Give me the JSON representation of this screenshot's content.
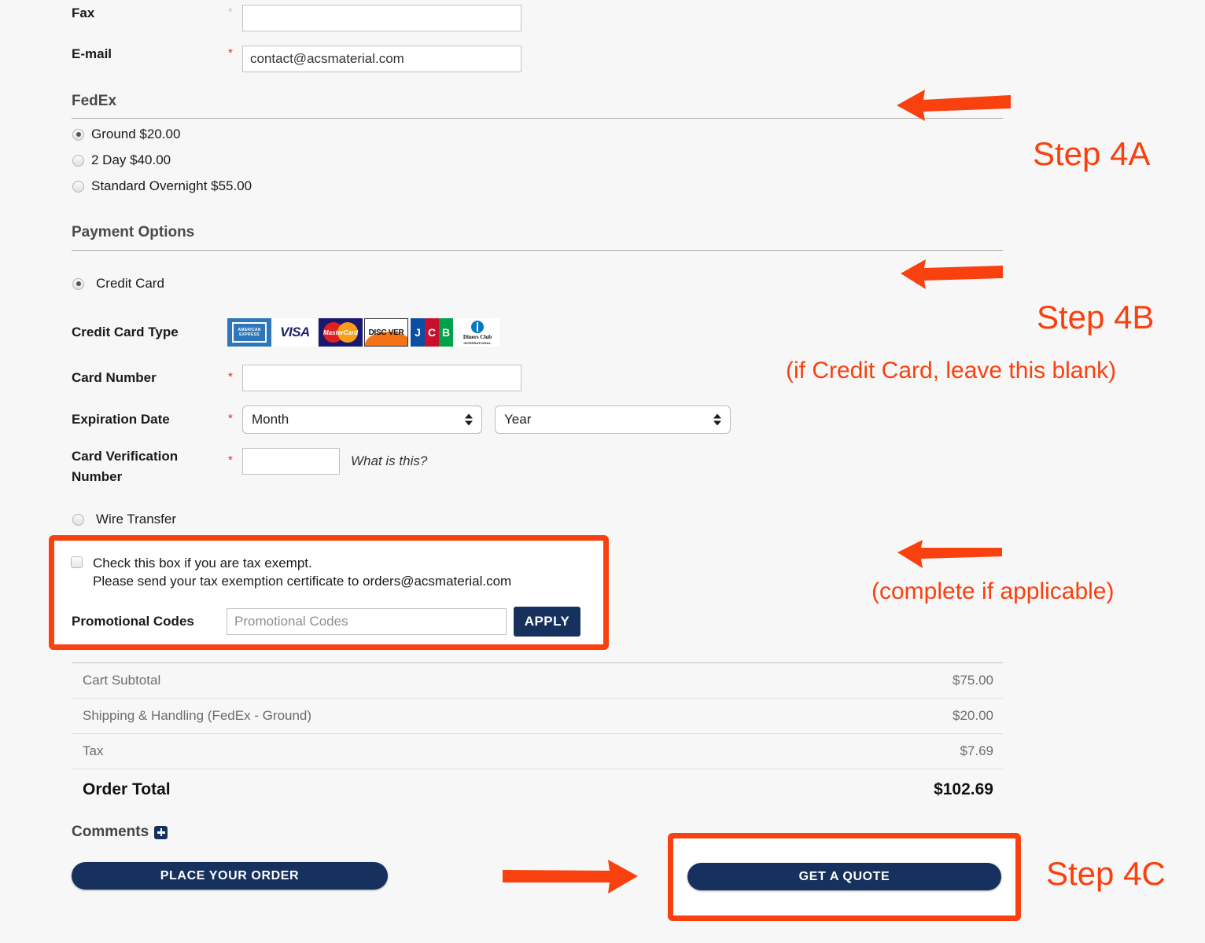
{
  "colors": {
    "accent_orange": "#f9400f",
    "navy": "#17315e",
    "required_red": "#e02b27",
    "page_bg": "#f7f7f7"
  },
  "contact": {
    "fax_label": "Fax",
    "fax_value": "",
    "fax_placeholder": "",
    "email_label": "E-mail",
    "email_value": "contact@acsmaterial.com",
    "required_marker": "*"
  },
  "shipping": {
    "heading": "FedEx",
    "options": [
      {
        "label": "Ground $20.00",
        "selected": true
      },
      {
        "label": "2 Day $40.00",
        "selected": false
      },
      {
        "label": "Standard Overnight $55.00",
        "selected": false
      }
    ]
  },
  "payment": {
    "heading": "Payment Options",
    "methods": [
      {
        "label": "Credit Card",
        "selected": true
      },
      {
        "label": "Wire Transfer",
        "selected": false
      }
    ],
    "card_type_label": "Credit Card Type",
    "card_logos": [
      "american-express-logo",
      "visa-logo",
      "mastercard-logo",
      "discover-logo",
      "jcb-logo",
      "diners-club-logo"
    ],
    "card_logo_text": {
      "amex_line1": "AMERICAN",
      "amex_line2": "EXPRESS",
      "visa": "VISA",
      "mastercard": "MasterCard",
      "discover": "DISC VER",
      "jcb_j": "J",
      "jcb_c": "C",
      "jcb_b": "B",
      "diners_line1": "Diners Club",
      "diners_line2": "INTERNATIONAL"
    },
    "card_number_label": "Card Number",
    "card_number_value": "",
    "expiration_label": "Expiration Date",
    "month_selected": "Month",
    "year_selected": "Year",
    "cvn_label_line1": "Card Verification",
    "cvn_label_line2": "Number",
    "cvn_value": "",
    "what_is_this": "What is this?"
  },
  "tax_promo": {
    "tax_exempt_line1": "Check this box if you are tax exempt.",
    "tax_exempt_line2": "Please send your tax exemption certificate to orders@acsmaterial.com",
    "tax_exempt_checked": false,
    "promo_label": "Promotional Codes",
    "promo_value": "",
    "promo_placeholder": "Promotional Codes",
    "apply_label": "APPLY"
  },
  "totals": {
    "rows": [
      {
        "label": "Cart Subtotal",
        "value": "$75.00"
      },
      {
        "label": "Shipping & Handling (FedEx - Ground)",
        "value": "$20.00"
      },
      {
        "label": "Tax",
        "value": "$7.69"
      }
    ],
    "grand_label": "Order Total",
    "grand_value": "$102.69"
  },
  "footer": {
    "comments_label": "Comments",
    "comments_toggle_icon": "plus-icon",
    "place_order_label": "PLACE YOUR ORDER",
    "get_quote_label": "GET A QUOTE"
  },
  "annotations": {
    "step_4a": "Step 4A",
    "step_4b": "Step 4B",
    "step_4b_note": "(if Credit Card, leave this blank)",
    "tax_note": "(complete if applicable)",
    "step_4c": "Step 4C"
  }
}
